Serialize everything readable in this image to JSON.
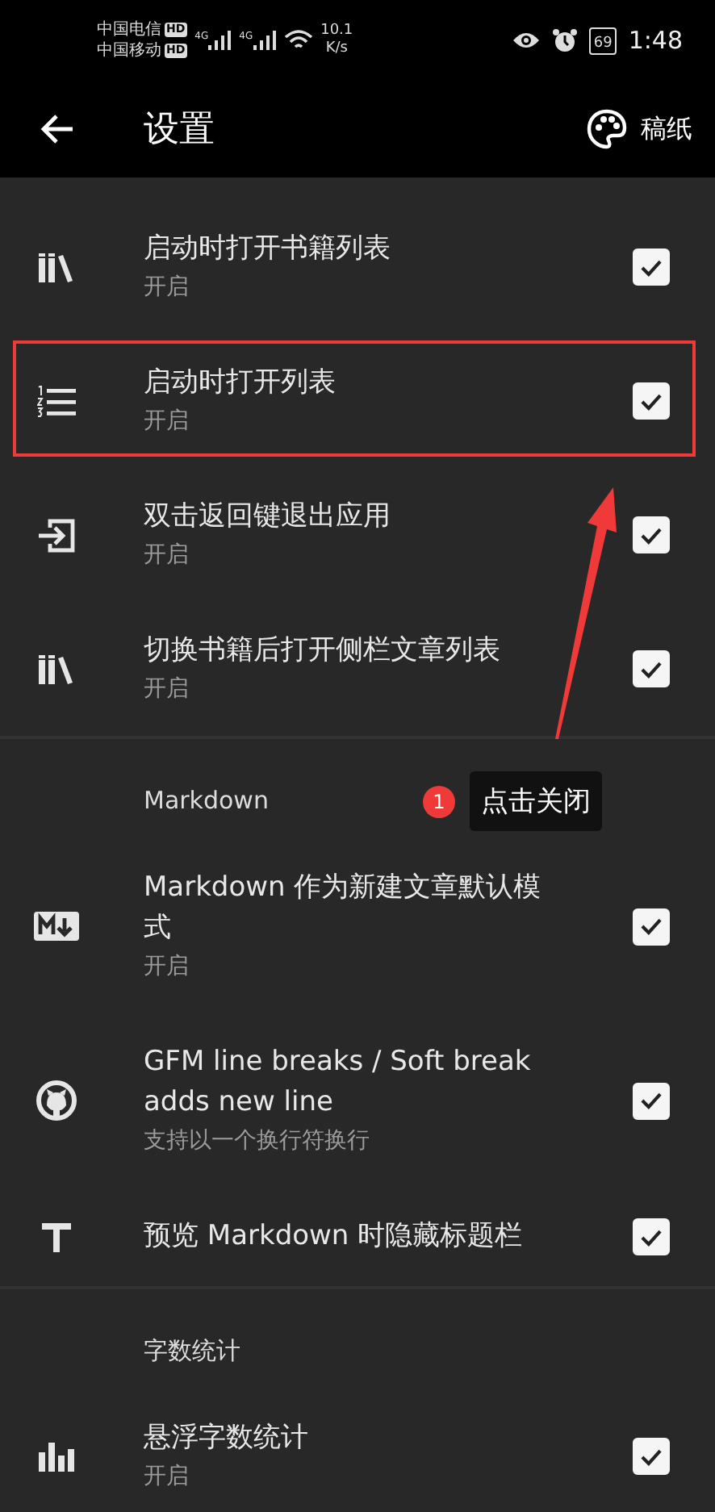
{
  "status_bar": {
    "carriers": [
      {
        "name": "中国电信",
        "badge": "HD"
      },
      {
        "name": "中国移动",
        "badge": "HD"
      }
    ],
    "signals": [
      "4G",
      "4G"
    ],
    "speed": "10.1",
    "speed_unit": "K/s",
    "battery": "69",
    "time": "1:48"
  },
  "app_bar": {
    "title": "设置",
    "action": "稿纸"
  },
  "sections": [
    {
      "rows": [
        {
          "title": "启动时打开书籍列表",
          "summary": "开启",
          "checked": true,
          "highlighted": false
        },
        {
          "title": "启动时打开列表",
          "summary": "开启",
          "checked": true,
          "highlighted": true
        },
        {
          "title": "双击返回键退出应用",
          "summary": "开启",
          "checked": true,
          "highlighted": false
        },
        {
          "title": "切换书籍后打开侧栏文章列表",
          "summary": "开启",
          "checked": true,
          "highlighted": false
        }
      ]
    },
    {
      "header": "Markdown",
      "rows": [
        {
          "title": "Markdown 作为新建文章默认模式",
          "summary": "开启",
          "checked": true,
          "highlighted": false
        },
        {
          "title": "GFM line breaks / Soft break adds new line",
          "summary": "支持以一个换行符换行",
          "checked": true,
          "highlighted": false
        },
        {
          "title": "预览 Markdown 时隐藏标题栏",
          "checked": true,
          "highlighted": false
        }
      ]
    },
    {
      "header": "字数统计",
      "rows": [
        {
          "title": "悬浮字数统计",
          "summary": "开启",
          "checked": true,
          "highlighted": false
        }
      ]
    }
  ],
  "annotation": {
    "step": "1",
    "note": "点击关闭"
  }
}
